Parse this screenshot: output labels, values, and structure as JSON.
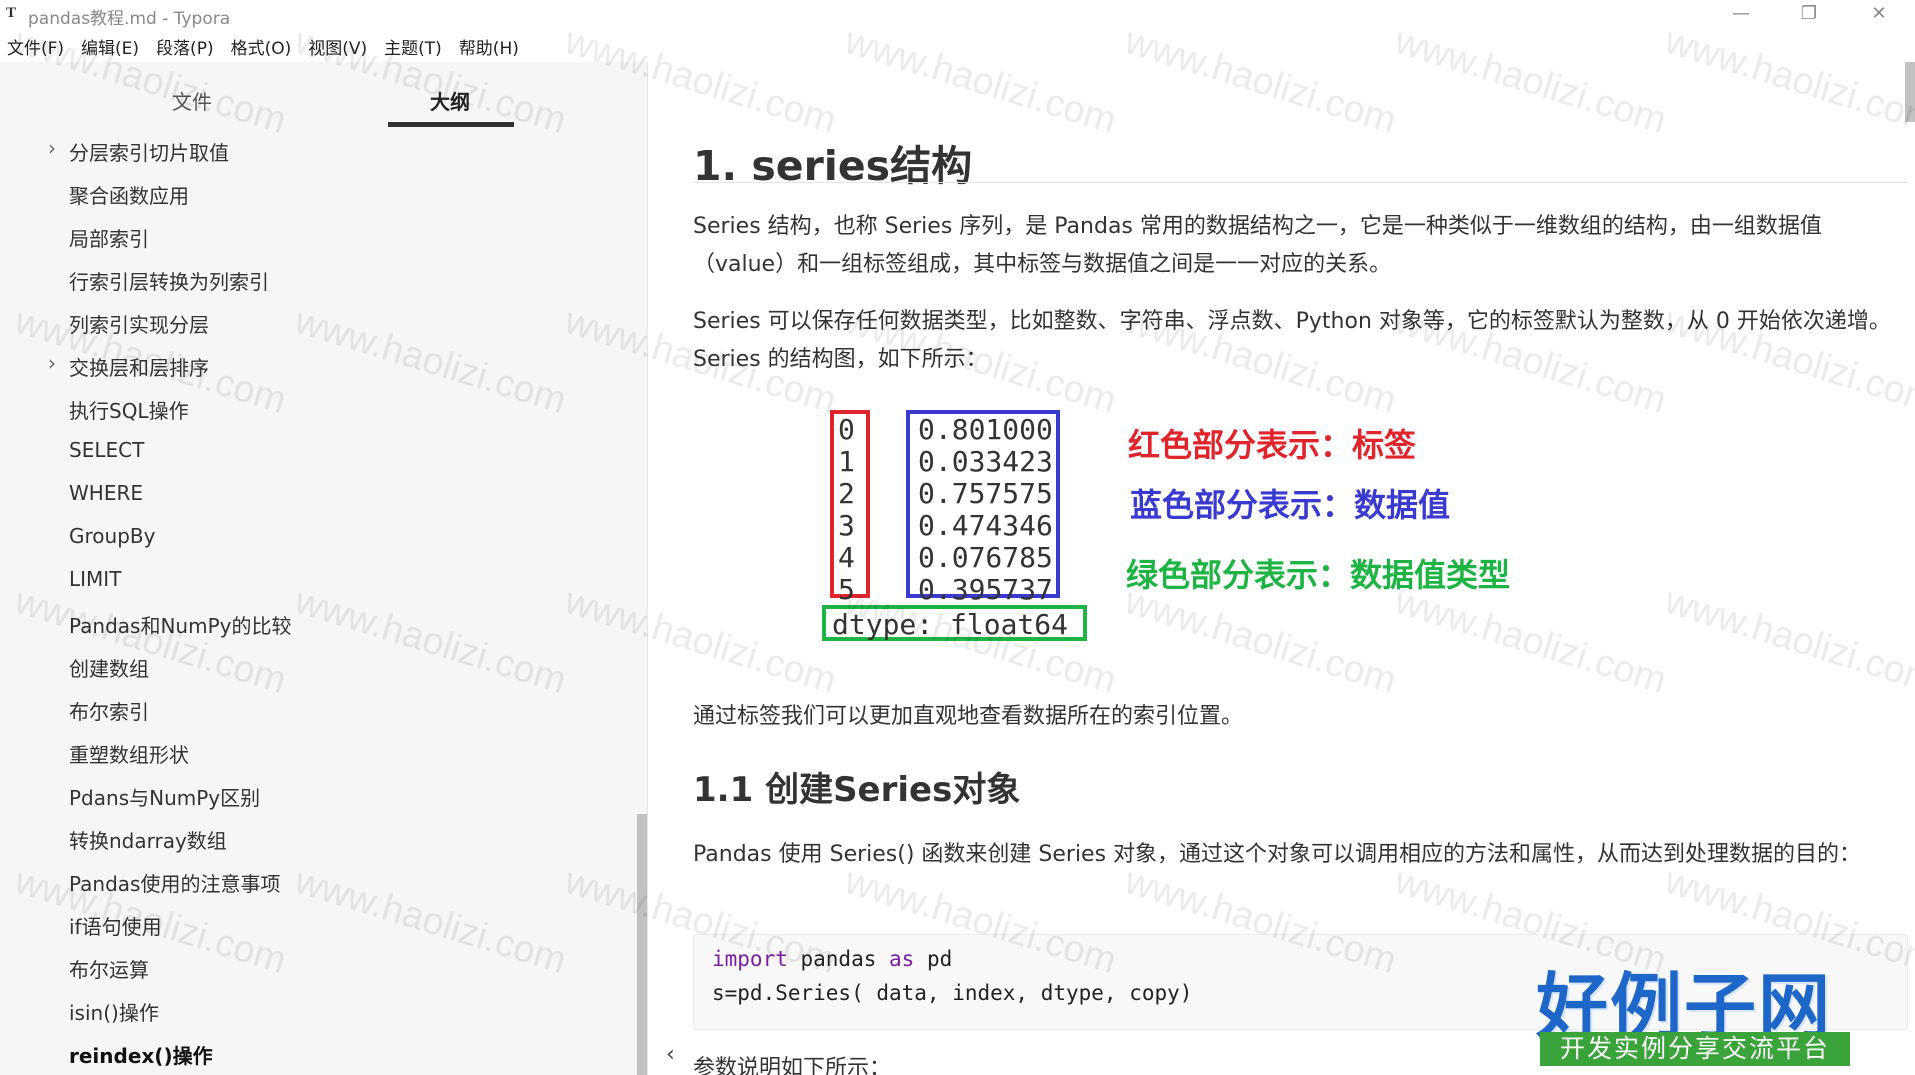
{
  "window": {
    "app_icon": "T",
    "title": "pandas教程.md - Typora",
    "minimize": "—",
    "maximize": "❐",
    "close": "✕"
  },
  "menu": [
    "文件(F)",
    "编辑(E)",
    "段落(P)",
    "格式(O)",
    "视图(V)",
    "主题(T)",
    "帮助(H)"
  ],
  "sidebar": {
    "tabs": [
      {
        "label": "文件",
        "active": false
      },
      {
        "label": "大纲",
        "active": true
      }
    ],
    "outline": [
      {
        "label": "分层索引切片取值",
        "chevron": true,
        "bold": false
      },
      {
        "label": "聚合函数应用",
        "chevron": false,
        "bold": false
      },
      {
        "label": "局部索引",
        "chevron": false,
        "bold": false
      },
      {
        "label": "行索引层转换为列索引",
        "chevron": false,
        "bold": false
      },
      {
        "label": "列索引实现分层",
        "chevron": false,
        "bold": false
      },
      {
        "label": "交换层和层排序",
        "chevron": true,
        "bold": false
      },
      {
        "label": "执行SQL操作",
        "chevron": false,
        "bold": false
      },
      {
        "label": "SELECT",
        "chevron": false,
        "bold": false
      },
      {
        "label": "WHERE",
        "chevron": false,
        "bold": false
      },
      {
        "label": "GroupBy",
        "chevron": false,
        "bold": false
      },
      {
        "label": "LIMIT",
        "chevron": false,
        "bold": false
      },
      {
        "label": "Pandas和NumPy的比较",
        "chevron": false,
        "bold": false
      },
      {
        "label": "创建数组",
        "chevron": false,
        "bold": false
      },
      {
        "label": "布尔索引",
        "chevron": false,
        "bold": false
      },
      {
        "label": "重塑数组形状",
        "chevron": false,
        "bold": false
      },
      {
        "label": "Pdans与NumPy区别",
        "chevron": false,
        "bold": false
      },
      {
        "label": "转换ndarray数组",
        "chevron": false,
        "bold": false
      },
      {
        "label": "Pandas使用的注意事项",
        "chevron": false,
        "bold": false
      },
      {
        "label": "if语句使用",
        "chevron": false,
        "bold": false
      },
      {
        "label": "布尔运算",
        "chevron": false,
        "bold": false
      },
      {
        "label": "isin()操作",
        "chevron": false,
        "bold": false
      },
      {
        "label": "reindex()操作",
        "chevron": false,
        "bold": true
      }
    ],
    "chevron_glyph": "›"
  },
  "content": {
    "h1": "1. series结构",
    "p1": "Series 结构，也称 Series 序列，是 Pandas 常用的数据结构之一，它是一种类似于一维数组的结构，由一组数据值（value）和一组标签组成，其中标签与数据值之间是一一对应的关系。",
    "p2": "Series 可以保存任何数据类型，比如整数、字符串、浮点数、Python 对象等，它的标签默认为整数，从 0 开始依次递增。Series 的结构图，如下所示：",
    "figure": {
      "index": [
        "0",
        "1",
        "2",
        "3",
        "4",
        "5"
      ],
      "values": [
        "0.801000",
        "0.033423",
        "0.757575",
        "0.474346",
        "0.076785",
        "0.395737"
      ],
      "dtype": "dtype:  float64",
      "legend_red": "红色部分表示：标签",
      "legend_blue": "蓝色部分表示：数据值",
      "legend_green": "绿色部分表示：数据值类型",
      "colors": {
        "red": "#e0242c",
        "blue": "#3a3ad0",
        "green": "#1db443"
      }
    },
    "p3": "通过标签我们可以更加直观地查看数据所在的索引位置。",
    "h2": "1.1 创建Series对象",
    "p4": "Pandas 使用 Series() 函数来创建 Series 对象，通过这个对象可以调用相应的方法和属性，从而达到处理数据的目的：",
    "code": {
      "line1_kw1": "import",
      "line1_mid": " pandas ",
      "line1_kw2": "as",
      "line1_end": " pd",
      "line2": "s=pd.Series( data, index, dtype, copy)"
    },
    "p5": "参数说明如下所示：",
    "collapse_glyph": "‹"
  },
  "watermark": {
    "text": "www.haolizi.com",
    "logo": "好例子网",
    "logo_sub": "开发实例分享交流平台"
  }
}
